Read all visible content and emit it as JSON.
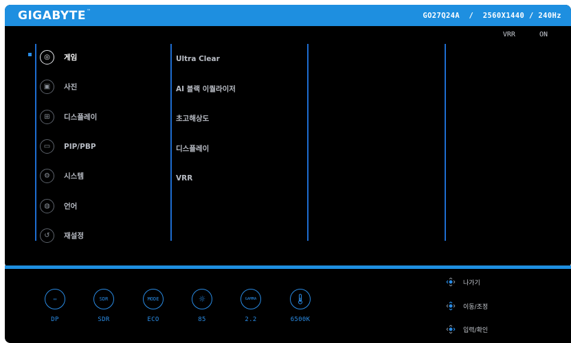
{
  "header": {
    "brand": "GIGABYTE",
    "trademark": "™",
    "model_info": "GO27Q24A  /  2560X1440 / 240Hz"
  },
  "status": {
    "label": "VRR",
    "value": "ON"
  },
  "menu": {
    "items": [
      {
        "label": "게임",
        "icon": "gamepad-icon",
        "glyph": "◎",
        "active": true
      },
      {
        "label": "사진",
        "icon": "picture-icon",
        "glyph": "▣",
        "active": false
      },
      {
        "label": "디스플레이",
        "icon": "display-icon",
        "glyph": "⊞",
        "active": false
      },
      {
        "label": "PIP/PBP",
        "icon": "pip-icon",
        "glyph": "▭",
        "active": false
      },
      {
        "label": "시스템",
        "icon": "system-gear-icon",
        "glyph": "⚙",
        "active": false
      },
      {
        "label": "언어",
        "icon": "globe-icon",
        "glyph": "◍",
        "active": false
      },
      {
        "label": "재설정",
        "icon": "reset-icon",
        "glyph": "↺",
        "active": false
      }
    ]
  },
  "submenu": {
    "items": [
      "Ultra Clear",
      "AI 블랙 이퀄라이저",
      "초고해상도",
      "디스플레이",
      "VRR"
    ]
  },
  "quick_settings": [
    {
      "name": "input-source",
      "ring_text": "▭",
      "label": "DP",
      "icon": "displayport-icon"
    },
    {
      "name": "dynamic-range",
      "ring_text": "SDR",
      "label": "SDR",
      "icon": "sdr-icon"
    },
    {
      "name": "picture-mode",
      "ring_text": "MODE",
      "label": "ECO",
      "icon": "mode-icon"
    },
    {
      "name": "brightness",
      "ring_text": "☼",
      "label": "85",
      "icon": "brightness-icon"
    },
    {
      "name": "gamma",
      "ring_text": "GAMMA",
      "label": "2.2",
      "icon": "gamma-icon"
    },
    {
      "name": "color-temperature",
      "ring_text": "🌡",
      "label": "6500K",
      "icon": "thermometer-icon"
    }
  ],
  "controls": [
    {
      "label": "나가기",
      "icon": "joystick-left-icon"
    },
    {
      "label": "이동/조정",
      "icon": "joystick-updown-icon"
    },
    {
      "label": "입력/확인",
      "icon": "joystick-press-icon"
    }
  ],
  "colors": {
    "accent": "#1e8fe0",
    "divider": "#1e6ed2",
    "background": "#000000"
  }
}
